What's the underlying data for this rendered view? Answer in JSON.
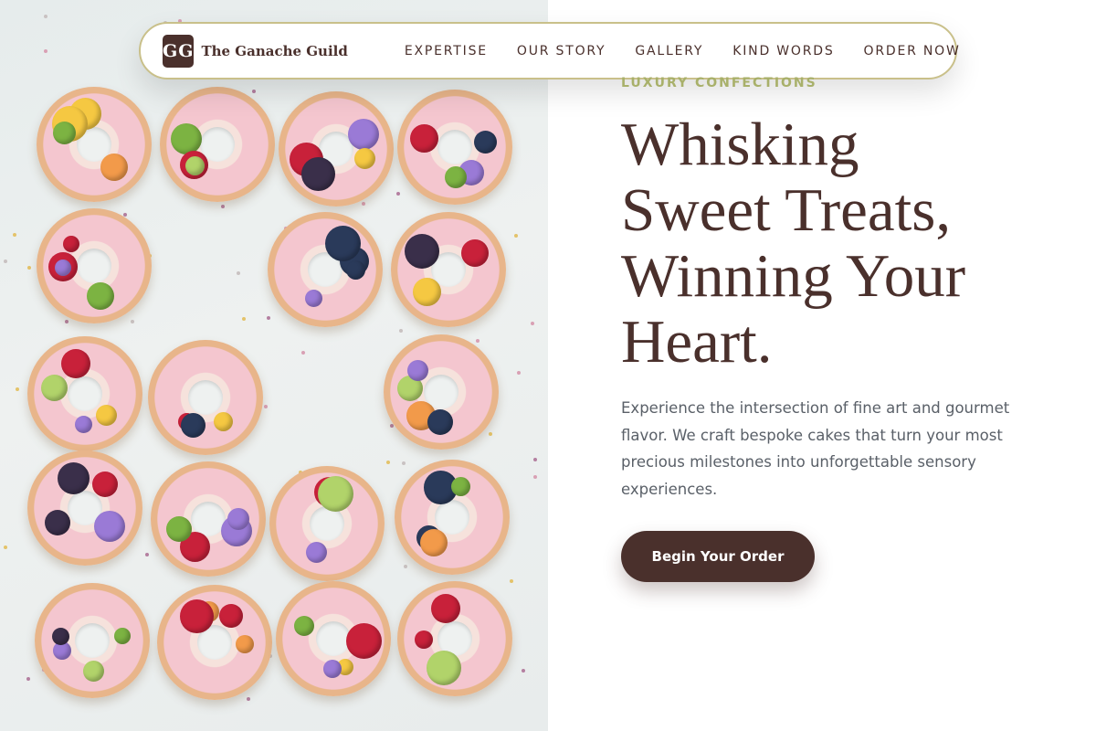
{
  "brand": {
    "logo_initials": "GG",
    "name": "The Ganache Guild"
  },
  "nav": {
    "links": [
      "EXPERTISE",
      "OUR STORY",
      "GALLERY",
      "KIND WORDS",
      "ORDER NOW"
    ]
  },
  "hero": {
    "eyebrow": "LUXURY CONFECTIONS",
    "headline_lines": [
      "Whisking",
      "Sweet Treats,",
      "Winning Your",
      "Heart."
    ],
    "description": "Experience the intersection of fine art and gourmet flavor. We craft bespoke cakes that turn your most precious milestones into unforgettable sensory experiences.",
    "cta_label": "Begin Your Order"
  },
  "colors": {
    "brand_brown": "#4a302c",
    "accent_olive": "#a8b06a",
    "nav_border": "#c9c08a",
    "body_text": "#5a6068"
  }
}
